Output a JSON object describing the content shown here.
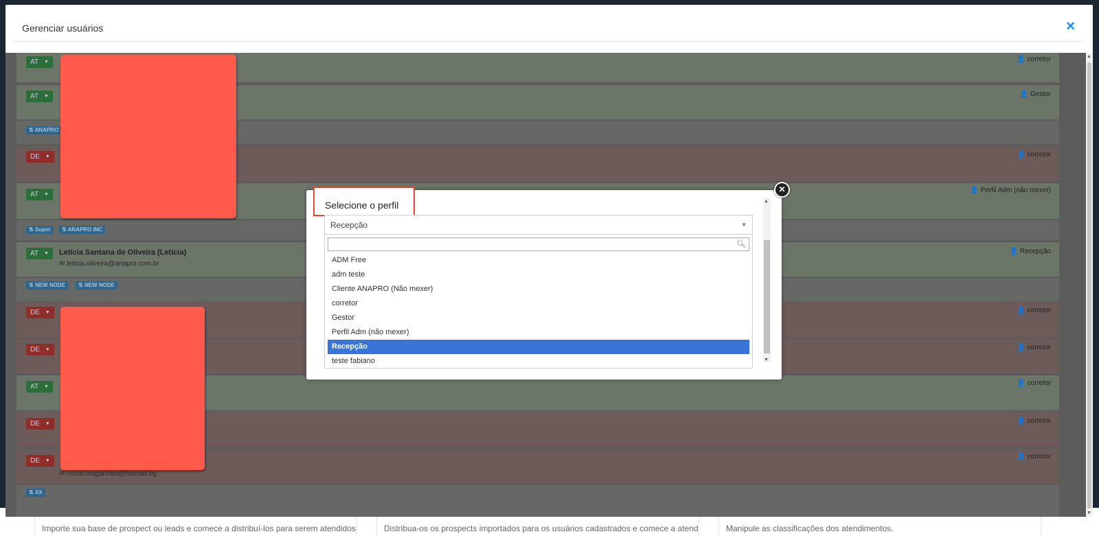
{
  "modal": {
    "title": "Gerenciar usuários",
    "close_icon": "×"
  },
  "background_texts": [
    "Importe sua base de prospect ou leads e comece a distribuí-los para serem atendidos",
    "Distribua-os os prospects importados para os usuários cadastrados e comece a atendê-los.",
    "Manipule as classificações dos atendimentos."
  ],
  "users": [
    {
      "status": "AT",
      "role": "corretor"
    },
    {
      "status": "AT",
      "role": "Gestor"
    },
    {
      "tags": [
        "ANAPRO"
      ]
    },
    {
      "status": "DE",
      "role": "corretor"
    },
    {
      "status": "AT",
      "role": "Perfil Adm (não mexer)"
    },
    {
      "tags": [
        "Super",
        "ANAPRO INC"
      ]
    },
    {
      "status": "AT",
      "role": "Recepção",
      "name": "Letícia Santana de Oliveira (Letícia)",
      "email": "leticia.oliveira@anapro.com.br"
    },
    {
      "tags": [
        "NEW NODE",
        "NEW NODE"
      ]
    },
    {
      "status": "DE",
      "role": "corretor"
    },
    {
      "status": "DE",
      "role": "corretor"
    },
    {
      "status": "AT",
      "role": "corretor"
    },
    {
      "status": "DE",
      "role": "corretor"
    },
    {
      "status": "DE",
      "role": "corretor",
      "email_partial": "rocco.maganhao@hotmail.bg"
    },
    {
      "tags": [
        "XX"
      ]
    }
  ],
  "picker": {
    "title": "Selecione o perfil",
    "selected": "Recepção",
    "search_value": "",
    "options": [
      "ADM Free",
      "adm teste",
      "Cliente ANAPRO (Não mexer)",
      "corretor",
      "Gestor",
      "Perfil Adm (não mexer)",
      "Recepção",
      "teste fabiano"
    ],
    "selected_index": 6
  },
  "icons": {
    "user": "user-icon",
    "envelope": "envelope-icon",
    "tag": "tag-icon",
    "search": "search-icon",
    "close": "close-icon"
  },
  "colors": {
    "accent": "#1e90d2",
    "active_badge": "#2b6e3a",
    "inactive_badge": "#8e2d2a",
    "selected_option": "#3875d7",
    "highlight_border": "#e3473a",
    "redaction": "#ff5a4b"
  }
}
